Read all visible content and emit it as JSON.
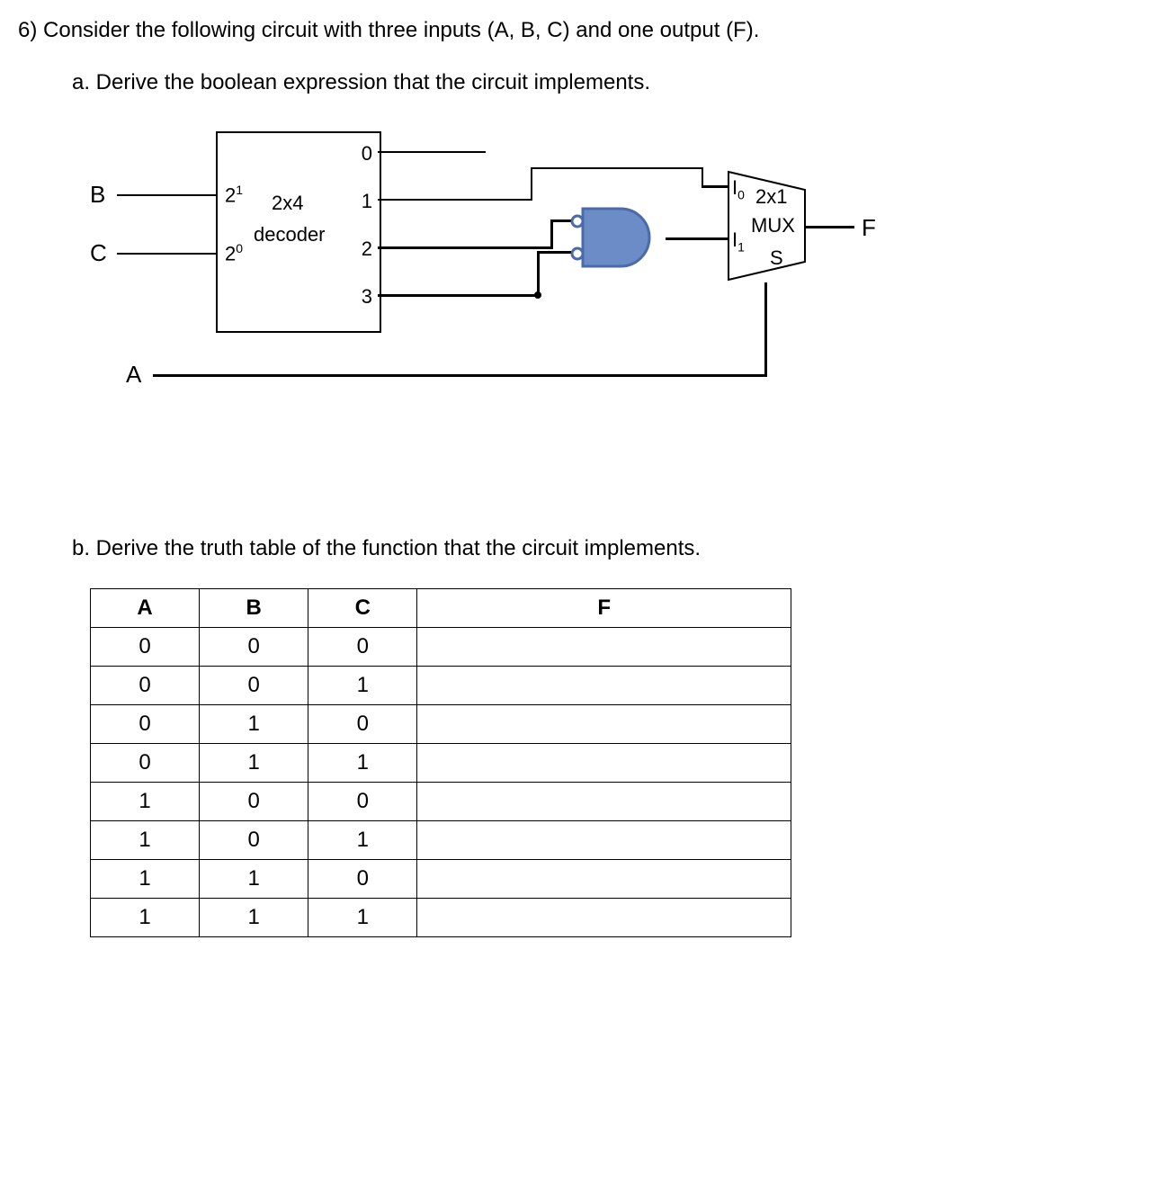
{
  "question": "6) Consider the following circuit with three inputs (A, B, C) and one output (F).",
  "parts": {
    "a": "a.  Derive the boolean expression that the circuit implements.",
    "b": "b.  Derive the truth table of the function that the circuit implements."
  },
  "circuit": {
    "inputs": {
      "b": "B",
      "c": "C",
      "a": "A"
    },
    "decoder": {
      "label1": "2x4",
      "label2": "decoder",
      "bitHigh": "2",
      "bitHighSup": "1",
      "bitLow": "2",
      "bitLowSup": "0",
      "out0": "0",
      "out1": "1",
      "out2": "2",
      "out3": "3"
    },
    "mux": {
      "label1": "2x1",
      "label2": "MUX",
      "i0": "I",
      "i0sub": "0",
      "i1": "I",
      "i1sub": "1",
      "sel": "S"
    },
    "output": "F"
  },
  "table": {
    "headers": {
      "a": "A",
      "b": "B",
      "c": "C",
      "f": "F"
    },
    "rows": [
      {
        "a": "0",
        "b": "0",
        "c": "0",
        "f": ""
      },
      {
        "a": "0",
        "b": "0",
        "c": "1",
        "f": ""
      },
      {
        "a": "0",
        "b": "1",
        "c": "0",
        "f": ""
      },
      {
        "a": "0",
        "b": "1",
        "c": "1",
        "f": ""
      },
      {
        "a": "1",
        "b": "0",
        "c": "0",
        "f": ""
      },
      {
        "a": "1",
        "b": "0",
        "c": "1",
        "f": ""
      },
      {
        "a": "1",
        "b": "1",
        "c": "0",
        "f": ""
      },
      {
        "a": "1",
        "b": "1",
        "c": "1",
        "f": ""
      }
    ]
  }
}
